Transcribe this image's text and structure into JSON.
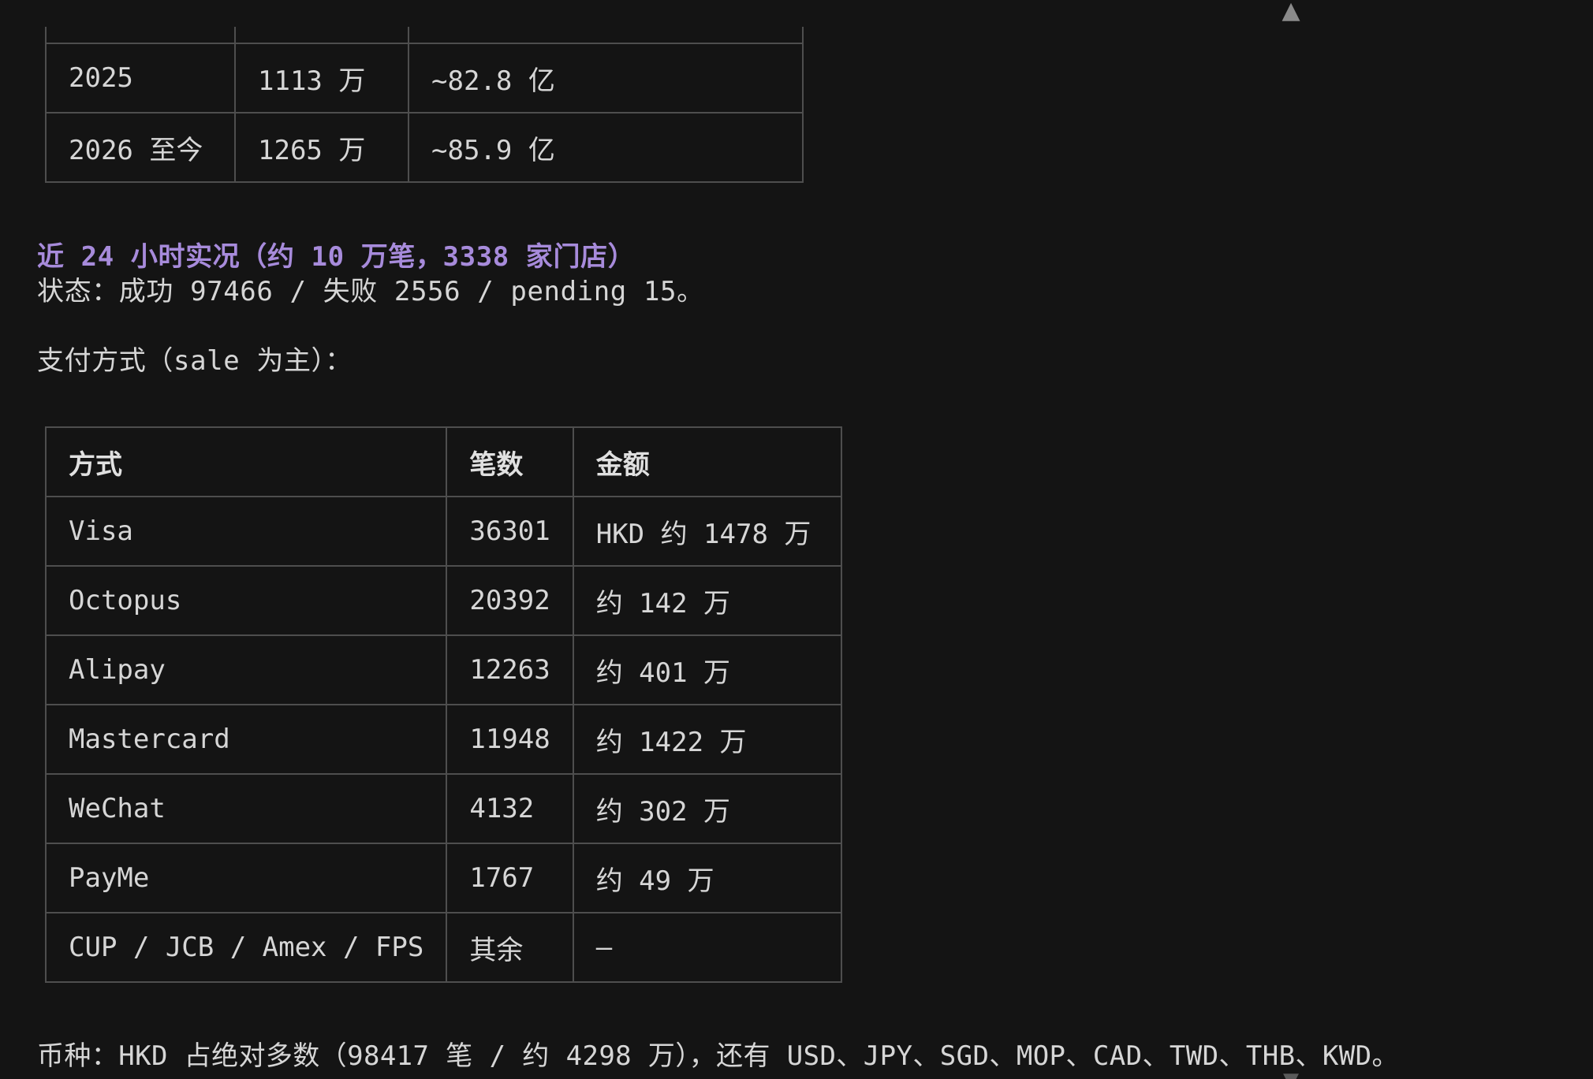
{
  "year_table": {
    "rows": [
      [
        "2025",
        "1113 万",
        "~82.8 亿"
      ],
      [
        "2026 至今",
        "1265 万",
        "~85.9 亿"
      ]
    ]
  },
  "recent": {
    "heading": "近 24 小时实况（约 10 万笔，3338 家门店）",
    "status_line": "状态：成功 97466 / 失败 2556 / pending 15。",
    "payment_intro": "支付方式（sale 为主）："
  },
  "payment_table": {
    "headers": [
      "方式",
      "笔数",
      "金额"
    ],
    "rows": [
      [
        "Visa",
        "36301",
        "HKD 约 1478 万"
      ],
      [
        "Octopus",
        "20392",
        "约 142 万"
      ],
      [
        "Alipay",
        "12263",
        "约 401 万"
      ],
      [
        "Mastercard",
        "11948",
        "约 1422 万"
      ],
      [
        "WeChat",
        "4132",
        "约 302 万"
      ],
      [
        "PayMe",
        "1767",
        "约 49 万"
      ],
      [
        "CUP / JCB / Amex / FPS",
        "其余",
        "—"
      ]
    ]
  },
  "currency_line": "币种：HKD 占绝对多数（98417 笔 / 约 4298 万），还有 USD、JPY、SGD、MOP、CAD、TWD、THB、KWD。",
  "icons": {
    "scroll_up": "▲",
    "scroll_down": "▼"
  },
  "colors": {
    "background": "#141414",
    "heading_accent": "#a78bdb",
    "text": "#d6d6d6",
    "border": "#4e4e4e"
  }
}
